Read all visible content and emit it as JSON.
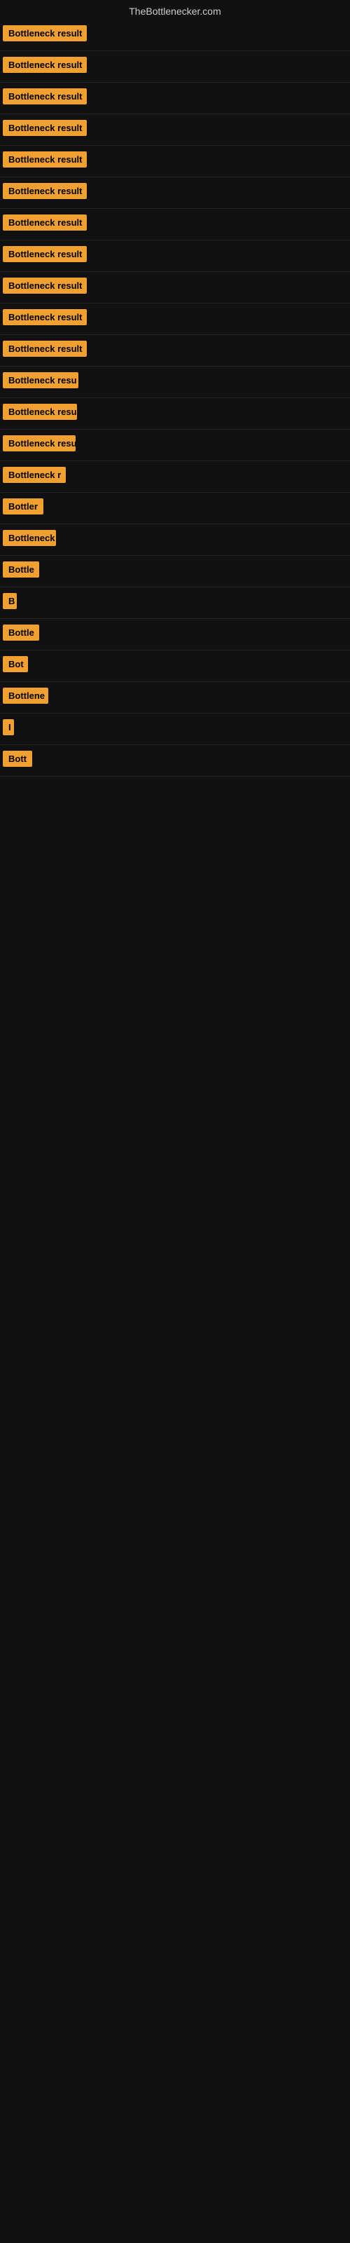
{
  "site": {
    "title": "TheBottlenecker.com"
  },
  "rows": [
    {
      "id": 1,
      "badge": "Bottleneck result",
      "width": 120
    },
    {
      "id": 2,
      "badge": "Bottleneck result",
      "width": 120
    },
    {
      "id": 3,
      "badge": "Bottleneck result",
      "width": 120
    },
    {
      "id": 4,
      "badge": "Bottleneck result",
      "width": 120
    },
    {
      "id": 5,
      "badge": "Bottleneck result",
      "width": 120
    },
    {
      "id": 6,
      "badge": "Bottleneck result",
      "width": 120
    },
    {
      "id": 7,
      "badge": "Bottleneck result",
      "width": 120
    },
    {
      "id": 8,
      "badge": "Bottleneck result",
      "width": 120
    },
    {
      "id": 9,
      "badge": "Bottleneck result",
      "width": 120
    },
    {
      "id": 10,
      "badge": "Bottleneck result",
      "width": 120
    },
    {
      "id": 11,
      "badge": "Bottleneck result",
      "width": 120
    },
    {
      "id": 12,
      "badge": "Bottleneck resu",
      "width": 108
    },
    {
      "id": 13,
      "badge": "Bottleneck resu",
      "width": 106
    },
    {
      "id": 14,
      "badge": "Bottleneck resu",
      "width": 104
    },
    {
      "id": 15,
      "badge": "Bottleneck r",
      "width": 90
    },
    {
      "id": 16,
      "badge": "Bottler",
      "width": 60
    },
    {
      "id": 17,
      "badge": "Bottleneck",
      "width": 76
    },
    {
      "id": 18,
      "badge": "Bottle",
      "width": 52
    },
    {
      "id": 19,
      "badge": "B",
      "width": 20
    },
    {
      "id": 20,
      "badge": "Bottle",
      "width": 52
    },
    {
      "id": 21,
      "badge": "Bot",
      "width": 36
    },
    {
      "id": 22,
      "badge": "Bottlene",
      "width": 65
    },
    {
      "id": 23,
      "badge": "I",
      "width": 14
    },
    {
      "id": 24,
      "badge": "Bott",
      "width": 42
    }
  ]
}
